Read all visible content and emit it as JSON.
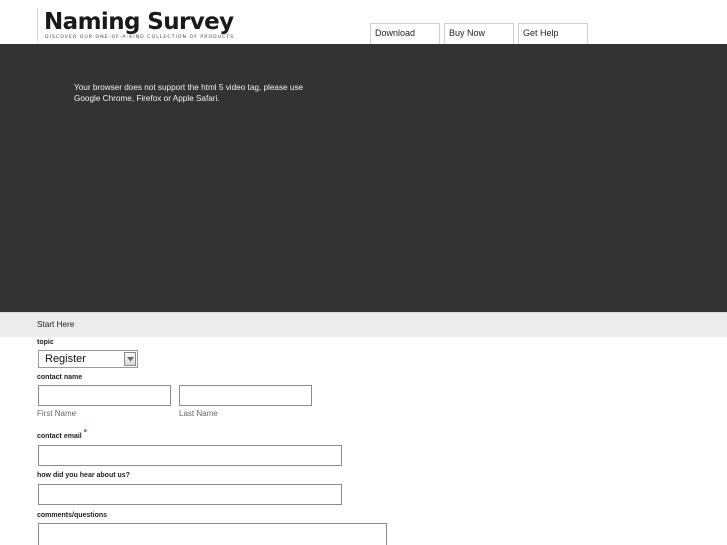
{
  "brand": {
    "title": "Naming Survey",
    "tagline": "DISCOVER OUR ONE-OF-A-KIND COLLECTION OF PRODUCTS"
  },
  "nav": {
    "items": [
      {
        "label": "Download"
      },
      {
        "label": "Buy Now"
      },
      {
        "label": "Get Help"
      }
    ]
  },
  "video": {
    "message": "Your browser does not support the html 5 video tag, please use Google Chrome, Firefox or Apple Safari."
  },
  "form": {
    "section_title": "Start Here",
    "topic": {
      "label": "topic",
      "selected": "Register"
    },
    "contact_name": {
      "label": "contact name",
      "first_sublabel": "First Name",
      "last_sublabel": "Last Name",
      "first_value": "",
      "last_value": ""
    },
    "contact_email": {
      "label": "contact email",
      "required_mark": "*",
      "value": ""
    },
    "hear_about": {
      "label": "how did you hear about us?",
      "value": ""
    },
    "comments": {
      "label": "comments/questions",
      "value": ""
    }
  },
  "colors": {
    "video_bg": "#333333",
    "section_bar": "#ececec",
    "required": "#dd2222"
  }
}
